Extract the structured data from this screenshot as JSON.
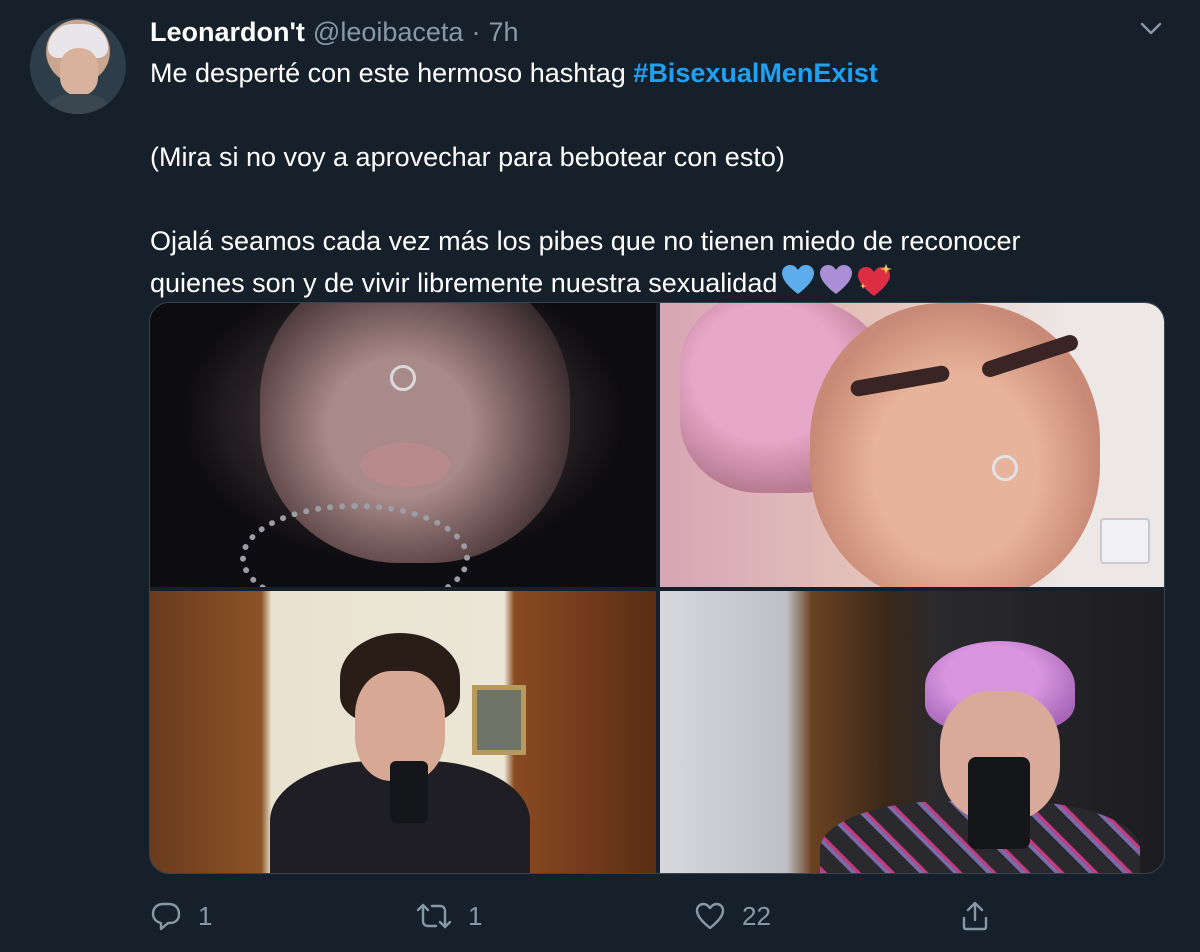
{
  "tweet": {
    "author": {
      "display_name": "Leonardon't",
      "handle": "@leoibaceta",
      "separator": "·",
      "time": "7h"
    },
    "text": {
      "line1_prefix": "Me desperté con este hermoso hashtag ",
      "hashtag": "#BisexualMenExist",
      "paragraph2": "(Mira si no voy a aprovechar para bebotear con esto)",
      "paragraph3_line1": "Ojalá seamos cada vez más los pibes que no tienen miedo de reconocer",
      "paragraph3_line2": "quienes son y de vivir libremente nuestra sexualidad"
    },
    "emojis": [
      "blue-heart",
      "purple-heart",
      "sparkling-heart"
    ],
    "media_count": 4,
    "actions": {
      "reply_count": "1",
      "retweet_count": "1",
      "like_count": "22"
    },
    "colors": {
      "background": "#15202b",
      "secondary_text": "#8899a6",
      "hashtag": "#1da1f2",
      "border": "#38444d"
    }
  }
}
